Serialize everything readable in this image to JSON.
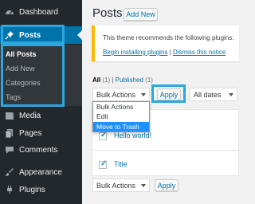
{
  "sidebar": {
    "items": [
      {
        "label": "Dashboard",
        "icon": "dashboard-icon"
      },
      {
        "label": "Posts",
        "icon": "pin-icon"
      },
      {
        "label": "Media",
        "icon": "media-icon"
      },
      {
        "label": "Pages",
        "icon": "pages-icon"
      },
      {
        "label": "Comments",
        "icon": "comment-icon"
      },
      {
        "label": "Appearance",
        "icon": "paintbrush-icon"
      },
      {
        "label": "Plugins",
        "icon": "plug-icon"
      }
    ],
    "submenu": [
      "All Posts",
      "Add New",
      "Categories",
      "Tags"
    ]
  },
  "header": {
    "title": "Posts",
    "add_new": "Add New"
  },
  "notice": {
    "text": "This theme recommends the following plugins:",
    "link1": "Begin installing plugins",
    "separator": "|",
    "link2": "Dismiss this notice"
  },
  "filters": {
    "all_label": "All",
    "all_count": "(1)",
    "sep": "|",
    "published_label": "Published",
    "published_count": "(1)"
  },
  "bulk_top": {
    "selected": "Bulk Actions",
    "apply": "Apply",
    "dates": "All dates"
  },
  "bulk_options": [
    "Bulk Actions",
    "Edit",
    "Move to Trash"
  ],
  "table": {
    "row1_title": "Hello world!",
    "header_title": "Title"
  },
  "bulk_bottom": {
    "selected": "Bulk Actions",
    "apply": "Apply"
  },
  "colors": {
    "accent": "#0073aa",
    "highlight": "#2aa6e0",
    "sidebar": "#23282d"
  }
}
